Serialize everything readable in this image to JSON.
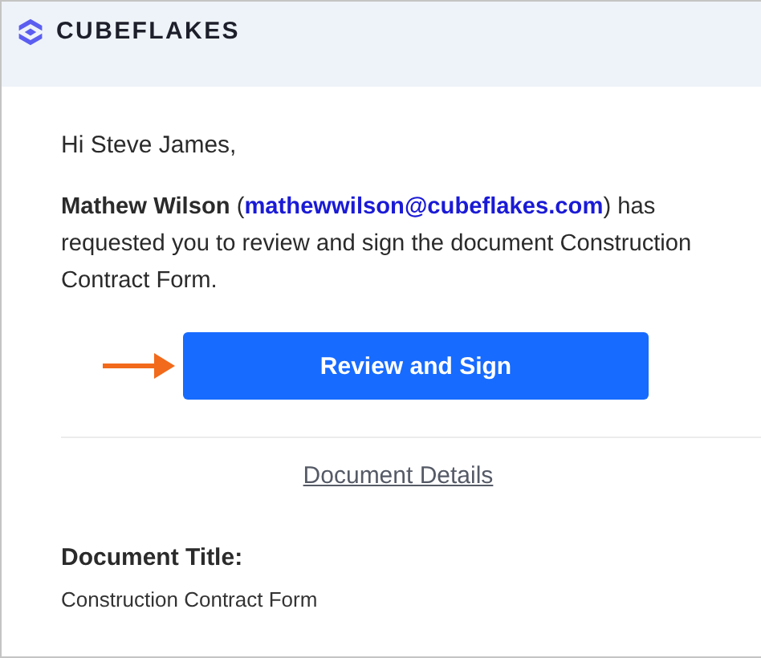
{
  "header": {
    "brand": "CUBEFLAKES"
  },
  "greeting": "Hi Steve James,",
  "message": {
    "before_link": "**Mathew Wilson** (",
    "email": "mathewwilson@cubeflakes.com",
    "after_link": ") has requested you to review and sign the document Construction Contract Form."
  },
  "primary_button": "Review and Sign",
  "details_link": "Document Details",
  "fields": [
    {
      "label": "Document Title:",
      "value": "Construction Contract Form"
    }
  ]
}
